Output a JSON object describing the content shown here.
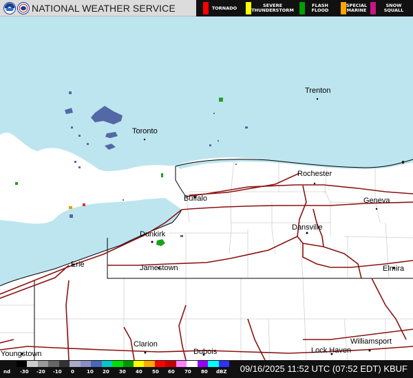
{
  "header": {
    "agency": "NATIONAL WEATHER SERVICE",
    "icons": {
      "left_logo": "noaa-logo-icon",
      "right_logo": "nws-logo-icon"
    },
    "warnings": [
      {
        "label": "TORNADO",
        "color": "#ff0000"
      },
      {
        "label": "SEVERE\nTHUNDERSTORM",
        "color": "#ffff00"
      },
      {
        "label": "FLASH\nFLOOD",
        "color": "#00a000"
      },
      {
        "label": "SPECIAL\nMARINE",
        "color": "#ffa500"
      },
      {
        "label": "SNOW\nSQUALL",
        "color": "#c71585"
      }
    ]
  },
  "map": {
    "colors": {
      "water": "#bde5ef",
      "land": "#ffffff",
      "border": "#000000",
      "county": "#cfcfcf",
      "highway": "#8b1010"
    },
    "cities": [
      {
        "name": "Trenton"
      },
      {
        "name": "Toronto"
      },
      {
        "name": "Rochester"
      },
      {
        "name": "Buffalo"
      },
      {
        "name": "Geneva"
      },
      {
        "name": "Dansville"
      },
      {
        "name": "Dunkirk"
      },
      {
        "name": "Erie"
      },
      {
        "name": "Jamestown"
      },
      {
        "name": "Elmira"
      },
      {
        "name": "Clarion"
      },
      {
        "name": "Dubois"
      },
      {
        "name": "Williamsport"
      },
      {
        "name": "Lock Haven"
      },
      {
        "name": "Youngstown"
      }
    ]
  },
  "footer": {
    "scale_labels": [
      "nd",
      "-30",
      "-20",
      "-10",
      "0",
      "10",
      "20",
      "30",
      "40",
      "50",
      "60",
      "70",
      "80",
      "dBZ"
    ],
    "scale_colors": [
      "#000000",
      "#cccccc",
      "#999999",
      "#666666",
      "#333333",
      "#a9a9c8",
      "#8c8cc8",
      "#4a67b8",
      "#00c8c8",
      "#00e000",
      "#009600",
      "#ffff00",
      "#ffaa00",
      "#ff0000",
      "#c80000",
      "#ff80ff",
      "#ffffff",
      "#9600ff",
      "#00ffff",
      "#3030ff"
    ],
    "timestamp": "09/16/2025 11:52 UTC (07:52 EDT)  KBUF"
  }
}
